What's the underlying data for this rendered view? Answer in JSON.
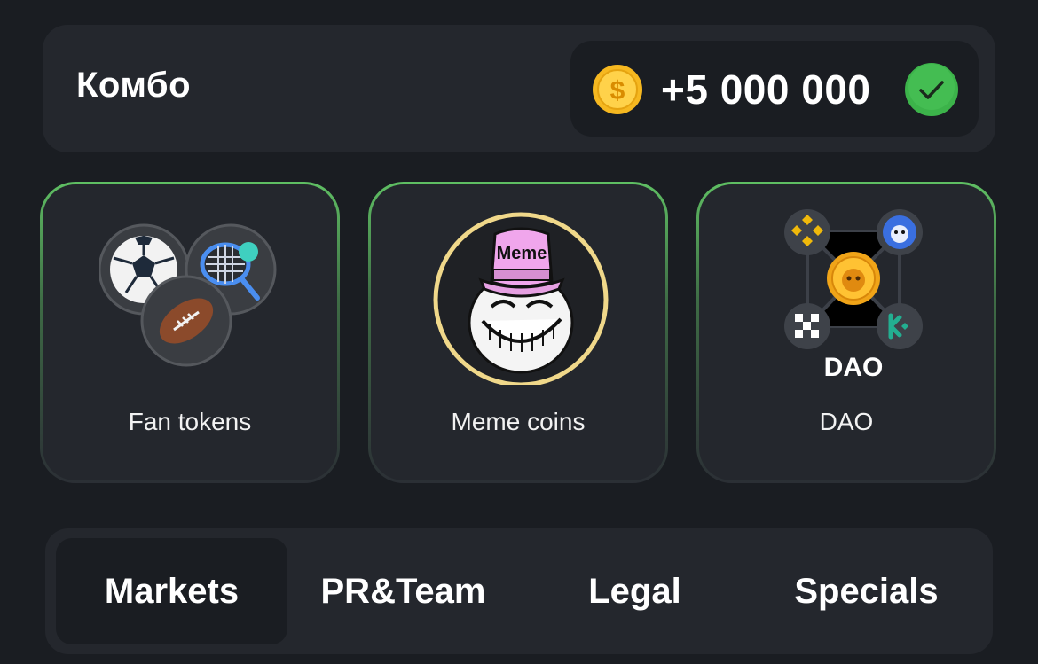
{
  "combo": {
    "title": "Комбо",
    "reward": "+5 000 000",
    "coin_icon": "gold-dollar-coin-icon",
    "status_icon": "check-circle-icon",
    "accent_color": "#3cb34a"
  },
  "cards": [
    {
      "label": "Fan tokens",
      "icon": "sports-balls-icon"
    },
    {
      "label": "Meme coins",
      "icon": "troll-face-meme-icon",
      "hat_text": "Meme"
    },
    {
      "label": "DAO",
      "icon": "dao-exchanges-icon",
      "art_text": "DAO"
    }
  ],
  "tabs": [
    {
      "label": "Markets",
      "active": true
    },
    {
      "label": "PR&Team",
      "active": false
    },
    {
      "label": "Legal",
      "active": false
    },
    {
      "label": "Specials",
      "active": false
    }
  ]
}
